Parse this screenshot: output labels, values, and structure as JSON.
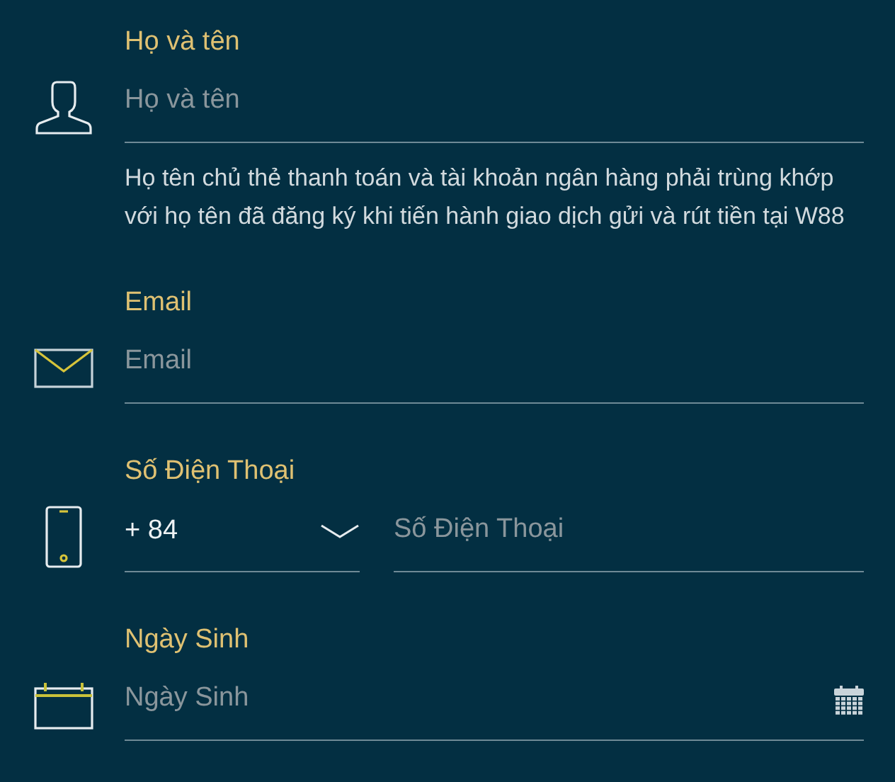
{
  "fields": [
    {
      "kind": "name",
      "label": "Họ và tên",
      "placeholder": "Họ và tên",
      "note": "Họ tên chủ thẻ thanh toán và tài khoản ngân hàng phải trùng khớp với họ tên đã đăng ký khi tiến hành giao dịch gửi và rút tiền tại W88"
    },
    {
      "kind": "email",
      "label": "Email",
      "placeholder": "Email"
    },
    {
      "kind": "phone",
      "label": "Số Điện Thoại",
      "country_code": "+ 84",
      "placeholder": "Số Điện Thoại"
    },
    {
      "kind": "date",
      "label": "Ngày Sinh",
      "placeholder": "Ngày Sinh"
    }
  ]
}
